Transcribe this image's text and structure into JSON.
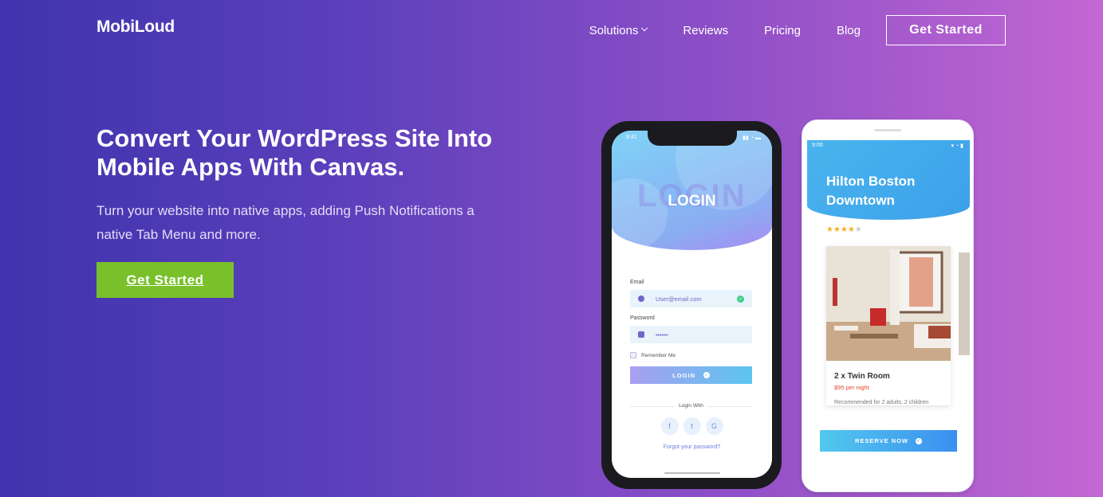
{
  "brand": {
    "logo": "MobiLoud"
  },
  "nav": {
    "items": [
      {
        "label": "Solutions",
        "has_dropdown": true
      },
      {
        "label": "Reviews"
      },
      {
        "label": "Pricing"
      },
      {
        "label": "Blog"
      }
    ],
    "cta": "Get Started"
  },
  "hero": {
    "title": "Convert Your WordPress Site Into Mobile Apps With Canvas.",
    "subtitle": "Turn your website into native apps, adding Push Notifications a native Tab Menu and more.",
    "button": "Get Started",
    "button_color": "#79c02a"
  },
  "phone_login": {
    "time": "9:41",
    "ghost_text": "LOGIN",
    "title": "LOGIN",
    "email_label": "Email",
    "email_value": "User@email.com",
    "password_label": "Password",
    "password_value": "••••••",
    "remember_label": "Remember Me",
    "login_button": "LOGIN",
    "login_with": "Login With",
    "socials": [
      "f",
      "t",
      "G"
    ],
    "forgot": "Forgot your password?"
  },
  "phone_hotel": {
    "time": "9:00",
    "title": "Hilton Boston Downtown",
    "rating": 4,
    "rating_max": 5,
    "room_name": "2 x Twin Room",
    "room_price": "$95 per night",
    "room_desc": "Recommended for 2 adults, 2 children",
    "reserve_button": "RESERVE NOW"
  }
}
